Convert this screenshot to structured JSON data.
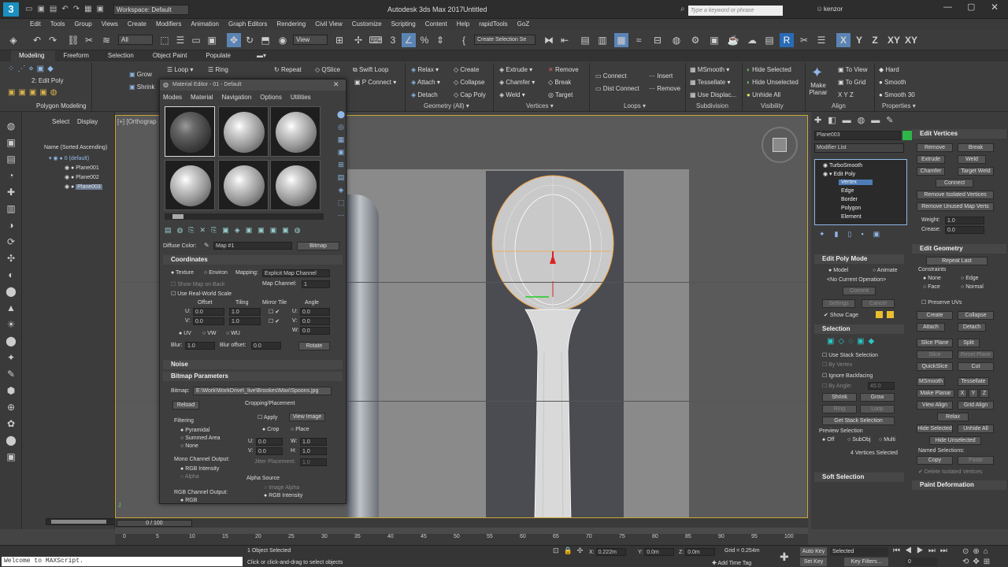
{
  "titlebar": {
    "app_title": "Autodesk 3ds Max 2017",
    "doc_title": "Untitled",
    "workspace": "Workspace: Default",
    "search_placeholder": "Type a keyword or phrase",
    "user": "kenzor",
    "icon": "3"
  },
  "menu": [
    "Edit",
    "Tools",
    "Group",
    "Views",
    "Create",
    "Modifiers",
    "Animation",
    "Graph Editors",
    "Rendering",
    "Civil View",
    "Customize",
    "Scripting",
    "Content",
    "Help",
    "rapidTools",
    "GoZ"
  ],
  "toolbar": {
    "filter": "All",
    "view": "View",
    "selection_set": "Create Selection Se",
    "axis_x": "X",
    "axis_y": "Y",
    "axis_z": "Z",
    "axis_xy": "XY",
    "axis_xyz": "XY"
  },
  "ribbon_tabs": [
    "Modeling",
    "Freeform",
    "Selection",
    "Object Paint",
    "Populate"
  ],
  "ribbon": {
    "mode": "2: Edit Poly",
    "polygon_modeling": "Polygon Modeling",
    "grow": "Grow",
    "shrink": "Shrink",
    "loop": "Loop",
    "ring": "Ring",
    "repeat": "Repeat",
    "qslice": "QSlice",
    "swift_loop": "Swift Loop",
    "p_connect": "P Connect",
    "relax": "Relax",
    "attach": "Attach",
    "detach": "Detach",
    "create": "Create",
    "collapse": "Collapse",
    "cap_poly": "Cap Poly",
    "extrude": "Extrude",
    "chamfer": "Chamfer",
    "weld": "Weld",
    "remove": "Remove",
    "break": "Break",
    "target": "Target",
    "connect": "Connect",
    "dist_connect": "Dist Connect",
    "insert": "Insert",
    "remove2": "Remove",
    "msmooth": "MSmooth",
    "tessellate": "Tessellate",
    "use_displac": "Use Displac...",
    "hide_selected": "Hide Selected",
    "hide_unselected": "Hide Unselected",
    "unhide_all": "Unhide All",
    "make_planar": "Make Planar",
    "to_view": "To View",
    "to_grid": "To Grid",
    "hard": "Hard",
    "smooth": "Smooth",
    "smooth30": "Smooth 30",
    "groups": {
      "geometry": "Geometry (All)",
      "vertices": "Vertices",
      "loops": "Loops",
      "subdivision": "Subdivision",
      "visibility": "Visibility",
      "align": "Align",
      "properties": "Properties"
    }
  },
  "scene_explorer": {
    "select": "Select",
    "display": "Display",
    "header": "Name (Sorted Ascending)",
    "items": [
      "0 (default)",
      "Plane001",
      "Plane002",
      "Plane003"
    ]
  },
  "viewport": {
    "label": "[+] [Orthograp"
  },
  "mat_editor": {
    "title": "Material Editor - 01 - Default",
    "menu": [
      "Modes",
      "Material",
      "Navigation",
      "Options",
      "Utilities"
    ],
    "diffuse_label": "Diffuse Color:",
    "map_name": "Map #1",
    "map_type": "Bitmap",
    "coordinates": "Coordinates",
    "texture": "Texture",
    "environ": "Environ",
    "mapping_label": "Mapping:",
    "mapping_value": "Explicit Map Channel",
    "show_map_on_back": "Show Map on Back",
    "map_channel_label": "Map Channel:",
    "map_channel_value": "1",
    "use_real_world": "Use Real-World Scale",
    "offset": "Offset",
    "tiling": "Tiling",
    "mirror_tile": "Mirror Tile",
    "angle": "Angle",
    "u_offset": "0.0",
    "v_offset": "0.0",
    "u_tiling": "1.0",
    "v_tiling": "1.0",
    "u_angle": "0.0",
    "v_angle": "0.0",
    "w_angle": "0.0",
    "uv": "UV",
    "vw": "VW",
    "wu": "WU",
    "blur_label": "Blur:",
    "blur_value": "1.0",
    "blur_offset_label": "Blur offset:",
    "blur_offset_value": "0.0",
    "rotate": "Rotate",
    "noise": "Noise",
    "bitmap_params": "Bitmap Parameters",
    "bitmap_label": "Bitmap:",
    "bitmap_path": "E:\\Work\\WorkDrive\\_live\\Brookes\\Max\\Spoons.jpg",
    "reload": "Reload",
    "cropping": "Cropping/Placement",
    "apply": "Apply",
    "view_image": "View Image",
    "crop": "Crop",
    "place": "Place",
    "u_crop": "0.0",
    "v_crop": "0.0",
    "w_crop": "1.0",
    "h_crop": "1.0",
    "jitter": "Jitter Placement:",
    "jitter_value": "1.0",
    "filtering": "Filtering",
    "pyramidal": "Pyramidal",
    "summed_area": "Summed Area",
    "none": "None",
    "mono_output": "Mono Channel Output:",
    "rgb_intensity": "RGB Intensity",
    "alpha": "Alpha",
    "rgb_output": "RGB Channel Output:",
    "rgb": "RGB",
    "alpha_source": "Alpha Source",
    "image_alpha": "Image Alpha",
    "rgb_intensity2": "RGB Intensity"
  },
  "cmd_panel": {
    "object_name": "Plane003",
    "modifier_list": "Modifier List",
    "stack": [
      "TurboSmooth",
      "Edit Poly",
      "Vertex",
      "Edge",
      "Border",
      "Polygon",
      "Element"
    ],
    "edit_poly_mode": "Edit Poly Mode",
    "model": "Model",
    "animate": "Animate",
    "no_current_op": "<No Current Operation>",
    "commit": "Commit",
    "settings": "Settings",
    "cancel": "Cancel",
    "show_cage": "Show Cage",
    "selection": "Selection",
    "use_stack_sel": "Use Stack Selection",
    "by_vertex": "By Vertex",
    "ignore_backfacing": "Ignore Backfacing",
    "by_angle": "By Angle:",
    "by_angle_val": "45.0",
    "shrink": "Shrink",
    "grow": "Grow",
    "ring": "Ring",
    "loop": "Loop",
    "get_stack_sel": "Get Stack Selection",
    "preview_sel": "Preview Selection",
    "off": "Off",
    "subobj": "SubObj",
    "multi": "Multi",
    "vertices_selected": "4 Vertices Selected",
    "soft_selection": "Soft Selection",
    "edit_vertices": "Edit Vertices",
    "remove": "Remove",
    "break": "Break",
    "extrude": "Extrude",
    "weld": "Weld",
    "chamfer": "Chamfer",
    "target_weld": "Target Weld",
    "connect": "Connect",
    "remove_isolated": "Remove Isolated Vertices",
    "remove_unused": "Remove Unused Map Verts",
    "weight_label": "Weight:",
    "weight_val": "1.0",
    "crease_label": "Crease:",
    "crease_val": "0.0",
    "edit_geometry": "Edit Geometry",
    "repeat_last": "Repeat Last",
    "constraints": "Constraints",
    "c_none": "None",
    "c_edge": "Edge",
    "c_face": "Face",
    "c_normal": "Normal",
    "preserve_uvs": "Preserve UVs",
    "create": "Create",
    "collapse": "Collapse",
    "attach": "Attach",
    "detach": "Detach",
    "slice_plane": "Slice Plane",
    "split": "Split",
    "slice": "Slice",
    "reset_plane": "Reset Plane",
    "quickslice": "QuickSlice",
    "cut": "Cut",
    "msmooth": "MSmooth",
    "tessellate": "Tessellate",
    "make_planar": "Make Planar",
    "x": "X",
    "y": "Y",
    "z": "Z",
    "view_align": "View Align",
    "grid_align": "Grid Align",
    "relax": "Relax",
    "hide_selected": "Hide Selected",
    "unhide_all": "Unhide All",
    "hide_unselected": "Hide Unselected",
    "named_selections": "Named Selections:",
    "copy": "Copy",
    "paste": "Paste",
    "delete_isolated": "Delete Isolated Vertices",
    "paint_deformation": "Paint Deformation"
  },
  "timeline": {
    "frame": "0 / 100",
    "ticks": [
      "0",
      "5",
      "10",
      "15",
      "20",
      "25",
      "30",
      "35",
      "40",
      "45",
      "50",
      "55",
      "60",
      "65",
      "70",
      "75",
      "80",
      "85",
      "90",
      "95",
      "100"
    ]
  },
  "status": {
    "maxscript": "Welcome to MAXScript.",
    "objects_selected": "1 Object Selected",
    "prompt": "Click or click-and-drag to select objects",
    "x_label": "X:",
    "x_val": "0.222m",
    "y_label": "Y:",
    "y_val": "0.0m",
    "z_label": "Z:",
    "z_val": "0.0m",
    "grid": "Grid = 0.254m",
    "add_time_tag": "Add Time Tag",
    "auto_key": "Auto Key",
    "selected": "Selected",
    "set_key": "Set Key",
    "key_filters": "Key Filters...",
    "frame_field": "0"
  }
}
